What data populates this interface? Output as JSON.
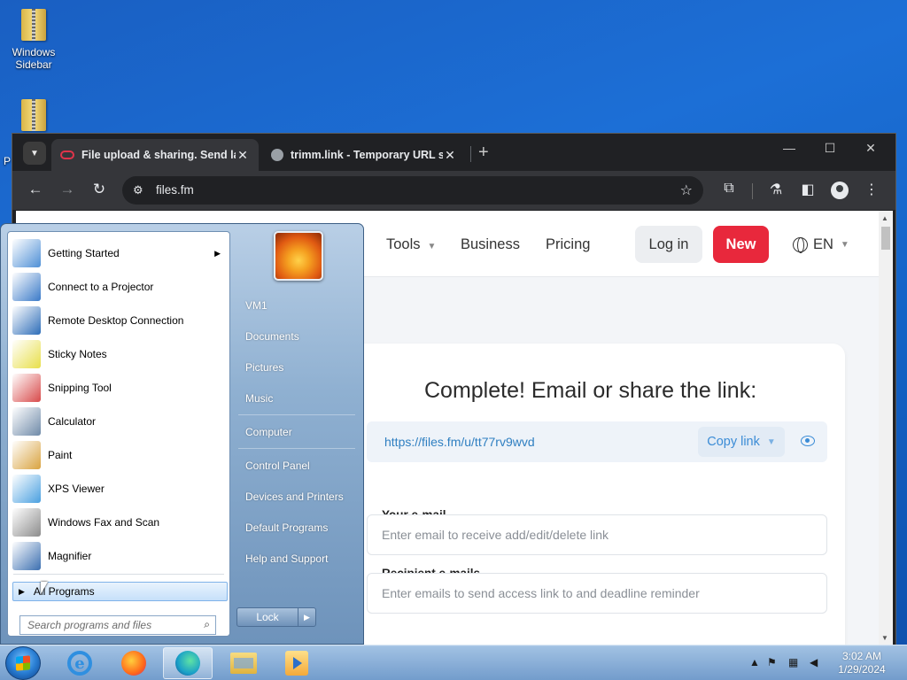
{
  "desktop": {
    "icons": [
      {
        "label": "Windows Sidebar"
      },
      {
        "label": "P"
      }
    ]
  },
  "browser": {
    "tabs": [
      {
        "title": "File upload & sharing. Send large files",
        "active": true
      },
      {
        "title": "trimm.link - Temporary URL shortener",
        "active": false
      }
    ],
    "address": "files.fm"
  },
  "site": {
    "nav": {
      "tools": "Tools",
      "business": "Business",
      "pricing": "Pricing",
      "login": "Log in",
      "new": "New",
      "lang": "EN"
    },
    "card": {
      "title": "Complete! Email or share the link:",
      "link": "https://files.fm/u/tt77rv9wvd",
      "copy": "Copy link",
      "email_label": "Your e-mail",
      "email_placeholder": "Enter email to receive add/edit/delete link",
      "recipients_label": "Recipient e-mails",
      "recipients_placeholder": "Enter emails to send access link to and deadline reminder"
    }
  },
  "startmenu": {
    "programs": [
      {
        "label": "Getting Started",
        "icon": "getting-started-icon",
        "color": "#4e8fd6",
        "submenu": true
      },
      {
        "label": "Connect to a Projector",
        "icon": "projector-icon",
        "color": "#3a7ac8"
      },
      {
        "label": "Remote Desktop Connection",
        "icon": "remote-desktop-icon",
        "color": "#2d6db8"
      },
      {
        "label": "Sticky Notes",
        "icon": "sticky-notes-icon",
        "color": "#e8df4a"
      },
      {
        "label": "Snipping Tool",
        "icon": "snipping-tool-icon",
        "color": "#d84a4a"
      },
      {
        "label": "Calculator",
        "icon": "calculator-icon",
        "color": "#6f8aa8"
      },
      {
        "label": "Paint",
        "icon": "paint-icon",
        "color": "#d9a340"
      },
      {
        "label": "XPS Viewer",
        "icon": "xps-viewer-icon",
        "color": "#4aa0e0"
      },
      {
        "label": "Windows Fax and Scan",
        "icon": "fax-scan-icon",
        "color": "#8c8c8c"
      },
      {
        "label": "Magnifier",
        "icon": "magnifier-icon",
        "color": "#3b6fb0"
      }
    ],
    "all_programs": "All Programs",
    "search_placeholder": "Search programs and files",
    "right": [
      "VM1",
      "Documents",
      "Pictures",
      "Music",
      "Computer",
      "Control Panel",
      "Devices and Printers",
      "Default Programs",
      "Help and Support"
    ],
    "lock": "Lock"
  },
  "taskbar": {
    "time": "3:02 AM",
    "date": "1/29/2024"
  }
}
